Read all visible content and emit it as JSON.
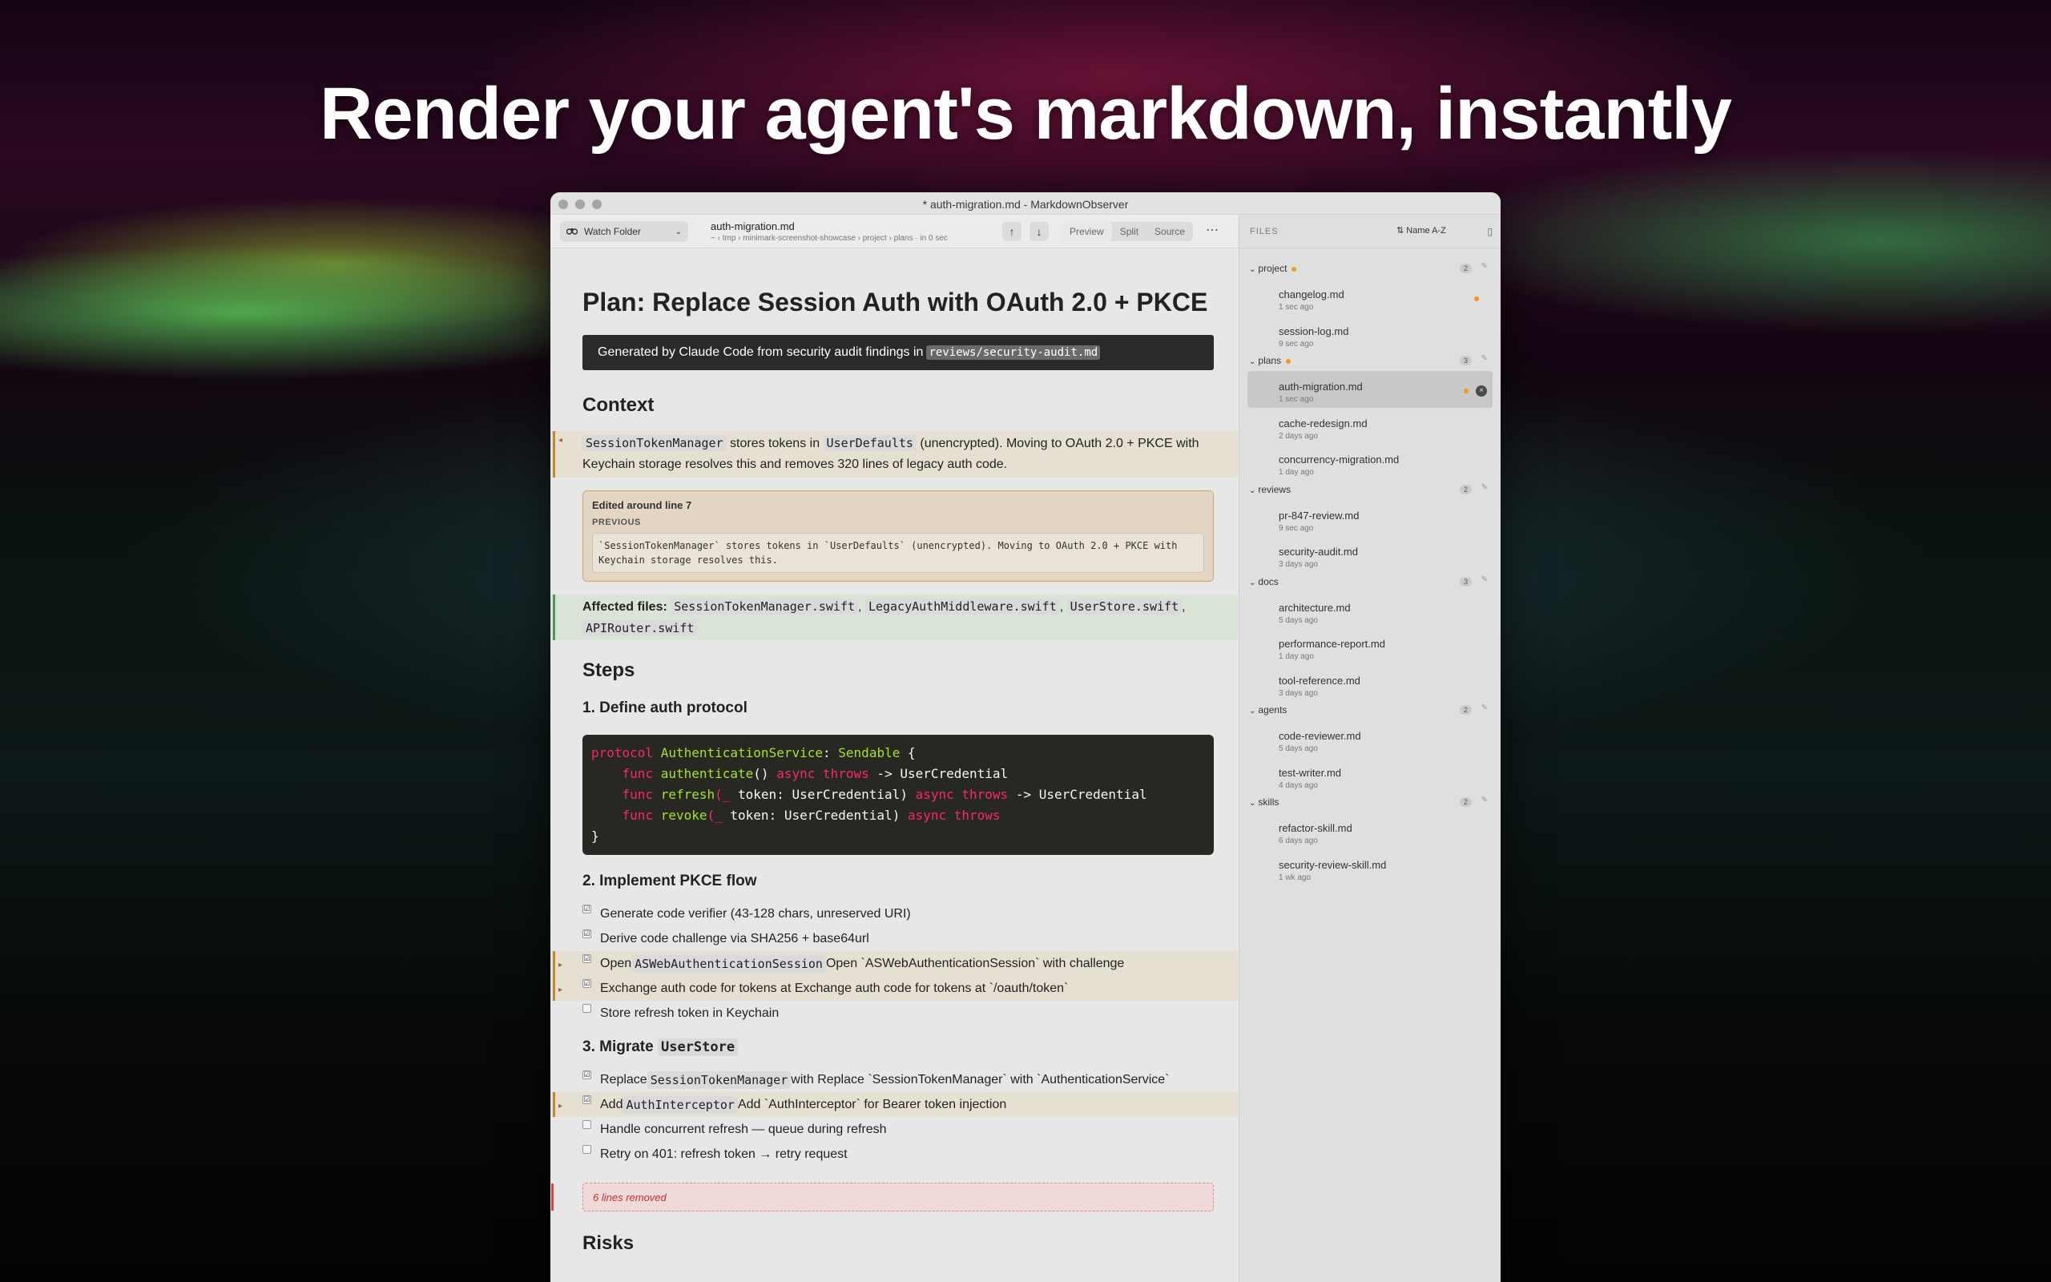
{
  "hero": {
    "title": "Render your agent's markdown, instantly"
  },
  "window": {
    "title": "* auth-migration.md - MarkdownObserver"
  },
  "toolbar": {
    "watch_label": "Watch Folder",
    "file_name": "auth-migration.md",
    "file_path": "~ › tmp › minimark-screenshot-showcase › project › plans · in 0 sec",
    "up": "↑",
    "down": "↓",
    "modes": [
      "Preview",
      "Split",
      "Source"
    ],
    "more": "⋯"
  },
  "doc": {
    "title": "Plan: Replace Session Auth with OAuth 2.0 + PKCE",
    "banner_text": "Generated by Claude Code from security audit findings in",
    "banner_code": "reviews/security-audit.md",
    "context_heading": "Context",
    "context_code1": "SessionTokenManager",
    "context_t1": " stores tokens in ",
    "context_code2": "UserDefaults",
    "context_t2": " (unencrypted). Moving to OAuth 2.0 + PKCE with Keychain storage resolves this and removes 320 lines of legacy auth code.",
    "edited_title": "Edited around line 7",
    "edited_prev_label": "PREVIOUS",
    "edited_prev_text": "`SessionTokenManager` stores tokens in `UserDefaults` (unencrypted). Moving to OAuth 2.0 + PKCE with Keychain storage resolves this.",
    "affected_label": "Affected files:",
    "affected_files": [
      "SessionTokenManager.swift",
      "LegacyAuthMiddleware.swift",
      "UserStore.swift",
      "APIRouter.swift"
    ],
    "sep": ",",
    "steps_heading": "Steps",
    "step1": "1. Define auth protocol",
    "code": {
      "l1a": "protocol",
      "l1b": "AuthenticationService",
      "l1c": ":",
      "l1d": "Sendable",
      "l1e": " {",
      "l2a": "    func",
      "l2b": " authenticate",
      "l2c": "()",
      "l2d": " async throws",
      "l2e": " -> UserCredential",
      "l3a": "    func",
      "l3b": " refresh",
      "l3c": "(_",
      "l3d": " token: UserCredential)",
      "l3e": " async throws",
      "l3f": " -> UserCredential",
      "l4a": "    func",
      "l4b": " revoke",
      "l4c": "(_",
      "l4d": " token: UserCredential)",
      "l4e": " async throws",
      "l5": "}"
    },
    "step2": "2. Implement PKCE flow",
    "tasks2": [
      {
        "check": "☑",
        "text": "Generate code verifier (43-128 chars, unreserved URI)"
      },
      {
        "check": "☑",
        "text": "Derive code challenge via SHA256 + base64url"
      },
      {
        "check": "☑",
        "pre": "Open ",
        "code": "ASWebAuthenticationSession",
        "text": " Open `ASWebAuthenticationSession` with challenge"
      },
      {
        "check": "☑",
        "text": "Exchange auth code for tokens at Exchange auth code for tokens at `/oauth/token`"
      },
      {
        "check": "",
        "text": "Store refresh token in Keychain"
      }
    ],
    "step3_pre": "3. Migrate ",
    "step3_code": "UserStore",
    "tasks3": [
      {
        "check": "☑",
        "pre": "Replace ",
        "code": "SessionTokenManager",
        "text": " with Replace `SessionTokenManager` with `AuthenticationService`"
      },
      {
        "check": "☑",
        "pre": "Add ",
        "code": "AuthInterceptor",
        "text": " Add `AuthInterceptor` for Bearer token injection"
      },
      {
        "check": "",
        "text": "Handle concurrent refresh — queue during refresh"
      },
      {
        "check": "",
        "text": "Retry on 401: refresh token → retry request"
      }
    ],
    "removed": "6 lines removed",
    "next_heading": "Risks"
  },
  "sidebar": {
    "label": "FILES",
    "sort": "⇅ Name A-Z",
    "panel_icon": "▯",
    "groups": [
      {
        "name": "project",
        "count": "2",
        "files": [
          {
            "name": "changelog.md",
            "age": "1 sec ago"
          },
          {
            "name": "session-log.md",
            "age": "9 sec ago"
          }
        ]
      },
      {
        "name": "plans",
        "count": "3",
        "files": [
          {
            "name": "auth-migration.md",
            "age": "1 sec ago"
          },
          {
            "name": "cache-redesign.md",
            "age": "2 days ago"
          },
          {
            "name": "concurrency-migration.md",
            "age": "1 day ago"
          }
        ]
      },
      {
        "name": "reviews",
        "count": "2",
        "files": [
          {
            "name": "pr-847-review.md",
            "age": "9 sec ago"
          },
          {
            "name": "security-audit.md",
            "age": "3 days ago"
          }
        ]
      },
      {
        "name": "docs",
        "count": "3",
        "files": [
          {
            "name": "architecture.md",
            "age": "5 days ago"
          },
          {
            "name": "performance-report.md",
            "age": "1 day ago"
          },
          {
            "name": "tool-reference.md",
            "age": "3 days ago"
          }
        ]
      },
      {
        "name": "agents",
        "count": "2",
        "files": [
          {
            "name": "code-reviewer.md",
            "age": "5 days ago"
          },
          {
            "name": "test-writer.md",
            "age": "4 days ago"
          }
        ]
      },
      {
        "name": "skills",
        "count": "2",
        "files": [
          {
            "name": "refactor-skill.md",
            "age": "6 days ago"
          },
          {
            "name": "security-review-skill.md",
            "age": "1 wk ago"
          }
        ]
      }
    ]
  },
  "icons": {
    "close": "×",
    "chevron_down": "⌄",
    "pin": "✎",
    "group_chevron": "⌄"
  }
}
